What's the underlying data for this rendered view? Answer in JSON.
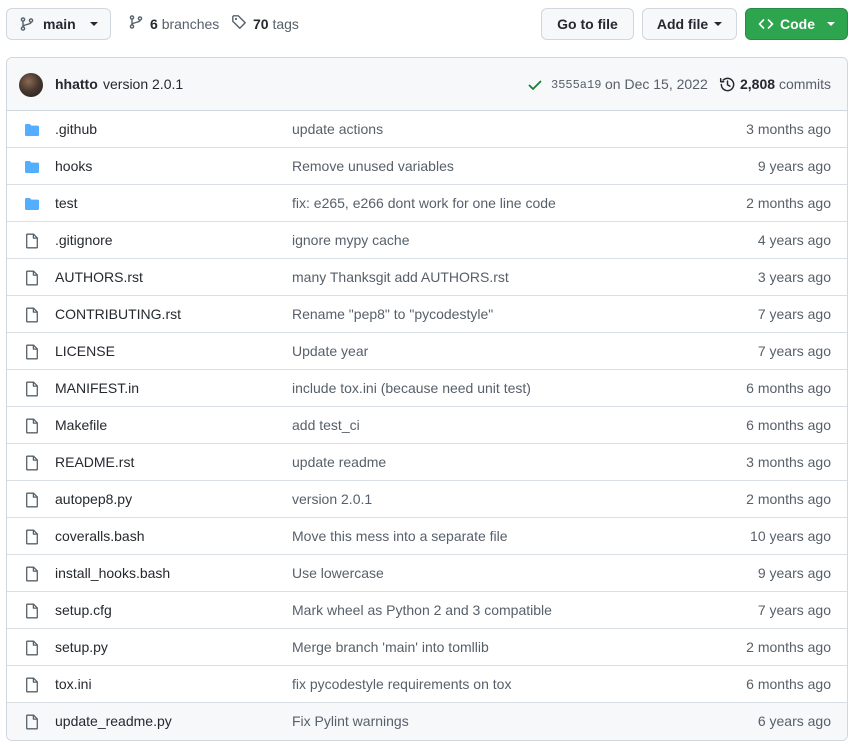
{
  "toolbar": {
    "branch": "main",
    "branches_count": "6",
    "branches_label": "branches",
    "tags_count": "70",
    "tags_label": "tags",
    "goto_file": "Go to file",
    "add_file": "Add file",
    "code": "Code"
  },
  "commit": {
    "author": "hhatto",
    "message": "version 2.0.1",
    "sha": "3555a19",
    "date": "on Dec 15, 2022",
    "count": "2,808",
    "count_label": "commits",
    "status": "success"
  },
  "files": [
    {
      "name": ".github",
      "type": "folder",
      "message": "update actions",
      "age": "3 months ago"
    },
    {
      "name": "hooks",
      "type": "folder",
      "message": "Remove unused variables",
      "age": "9 years ago"
    },
    {
      "name": "test",
      "type": "folder",
      "message": "fix: e265, e266 dont work for one line code",
      "age": "2 months ago"
    },
    {
      "name": ".gitignore",
      "type": "file",
      "message": "ignore mypy cache",
      "age": "4 years ago"
    },
    {
      "name": "AUTHORS.rst",
      "type": "file",
      "message": "many Thanksgit add AUTHORS.rst",
      "age": "3 years ago"
    },
    {
      "name": "CONTRIBUTING.rst",
      "type": "file",
      "message": "Rename \"pep8\" to \"pycodestyle\"",
      "age": "7 years ago"
    },
    {
      "name": "LICENSE",
      "type": "file",
      "message": "Update year",
      "age": "7 years ago"
    },
    {
      "name": "MANIFEST.in",
      "type": "file",
      "message": "include tox.ini (because need unit test)",
      "age": "6 months ago"
    },
    {
      "name": "Makefile",
      "type": "file",
      "message": "add test_ci",
      "age": "6 months ago"
    },
    {
      "name": "README.rst",
      "type": "file",
      "message": "update readme",
      "age": "3 months ago"
    },
    {
      "name": "autopep8.py",
      "type": "file",
      "message": "version 2.0.1",
      "age": "2 months ago"
    },
    {
      "name": "coveralls.bash",
      "type": "file",
      "message": "Move this mess into a separate file",
      "age": "10 years ago"
    },
    {
      "name": "install_hooks.bash",
      "type": "file",
      "message": "Use lowercase",
      "age": "9 years ago"
    },
    {
      "name": "setup.cfg",
      "type": "file",
      "message": "Mark wheel as Python 2 and 3 compatible",
      "age": "7 years ago"
    },
    {
      "name": "setup.py",
      "type": "file",
      "message": "Merge branch 'main' into tomllib",
      "age": "2 months ago"
    },
    {
      "name": "tox.ini",
      "type": "file",
      "message": "fix pycodestyle requirements on tox",
      "age": "6 months ago"
    },
    {
      "name": "update_readme.py",
      "type": "file",
      "message": "Fix Pylint warnings",
      "age": "6 years ago"
    }
  ],
  "colors": {
    "folder": "#54aeff",
    "file": "#57606a",
    "success": "#1a7f37",
    "code_button": "#2da44e"
  }
}
